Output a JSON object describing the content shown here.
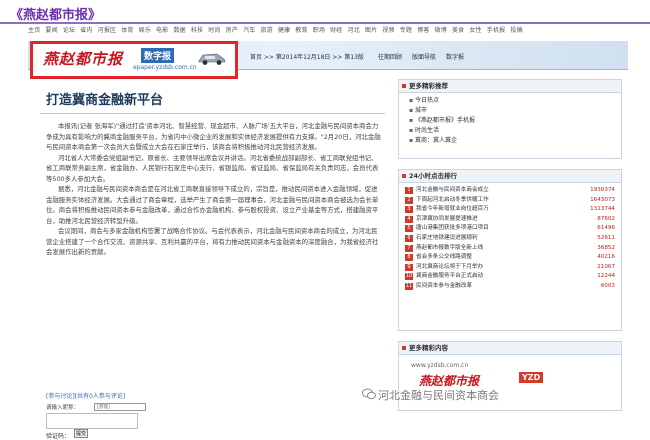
{
  "page_title": "《燕赵都市报》",
  "nav": [
    "主页",
    "要闻",
    "论坛",
    "省内",
    "河报区",
    "体育",
    "娱乐",
    "电影",
    "数据",
    "科技",
    "时尚",
    "房产",
    "汽车",
    "旅游",
    "健康",
    "教育",
    "职场",
    "财经",
    "河北",
    "图片",
    "视频",
    "专题",
    "博客",
    "微博",
    "美食",
    "女性",
    "手机报",
    "投稿"
  ],
  "banner": {
    "logo_text": "燕赵都市报",
    "digital_label": "数字报",
    "logo_url": "epaper.yzdsb.com.cn",
    "date_text": "首页 >> 第2014年12月18日 >> 第13版",
    "links": [
      "往期回顾",
      "版面导航",
      "数字报"
    ]
  },
  "article": {
    "title": "打造冀商金融新平台",
    "paragraphs": [
      "本报讯(记者 张海军)\"通过打造'资本河北、智慧经营、现金超市、人脉广场'五大平台，河北金融与民间资本商会力争成为具有影响力的冀商金融服务平台，为省内中小微企业的发展和实体经济发展提供有力支撑。\"2月20日，河北金融与民间资本商会第一次会员大会暨成立大会在石家庄举行，该商会将积极推动河北民营经济发展。",
      "河北省人大常委会党组副书记，原省长、主要领导出席会议并讲话。河北省委统战部副部长、省工商联党组书记、省工商联常务副主席，省金融办、人民银行石家庄中心支行、省银监局、省证监局、省保监局有关负责同志，会员代表等500多人参加大会。",
      "据悉，河北金融与民间资本商会是在河北省工商联直接领导下成立的，宗旨是，推动民间资本进入金融领域，促进金融服务实体经济发展。大会通过了商会章程，选举产生了商会第一届理事会，河北金融与民间资本商会被选为会长单位。商会将积极推动民间资本参与金融改革，通过合作办金融机构、参与股权投资、设立产业基金等方式，搭建融资平台，助推河北民营经济转型升级。",
      "会议期间，商会与多家金融机构签署了战略合作协议。与会代表表示，河北金融与民间资本商会的成立，为河北民营企业搭建了一个合作交流、资源共享、互利共赢的平台，将有力推动民间资本与金融资本的深度融合，为我省经济社会发展作出新的贡献。"
    ],
    "comment_head": "[参与讨论][共有0人参与评论]",
    "comment_label": "请输入昵称：",
    "comment_placeholder": "[游客]",
    "verify_label": "验证码：",
    "submit_label": "提交"
  },
  "sidebar": {
    "panel1_title": "更多精彩推荐",
    "panel1_items": [
      "今日热点",
      "城市",
      "《燕赵都市报》手机报",
      "时尚生活",
      "冀商：冀人冀企"
    ],
    "panel2_title": "24小时点击排行",
    "rank": [
      {
        "num": "1",
        "title": "河北金融与民间资本商会成立",
        "count": "1930374"
      },
      {
        "num": "2",
        "title": "下周起河北启动冬季供暖工作",
        "count": "1643073"
      },
      {
        "num": "3",
        "title": "我省今年新增就业岗位超百万",
        "count": "1313744"
      },
      {
        "num": "4",
        "title": "京津冀协同发展提速推进",
        "count": "87602"
      },
      {
        "num": "5",
        "title": "唐山港集团获批多项港口项目",
        "count": "61496"
      },
      {
        "num": "6",
        "title": "石家庄地铁建设进展顺利",
        "count": "52611"
      },
      {
        "num": "7",
        "title": "燕赵都市报数字版全新上线",
        "count": "36852"
      },
      {
        "num": "8",
        "title": "省会多条公交线路调整",
        "count": "40216"
      },
      {
        "num": "9",
        "title": "河北冀商论坛将于下月举办",
        "count": "21067"
      },
      {
        "num": "10",
        "title": "冀商金融服务平台正式启动",
        "count": "12244"
      },
      {
        "num": "11",
        "title": "民间资本参与金融改革",
        "count": "6003"
      }
    ],
    "panel3_title": "更多精彩内容",
    "ad_url": "www.yzdsb.com.cn",
    "ad_logo": "燕赵都市报",
    "ad_badge": "YZD"
  },
  "watermark": "河北金融与民间资本商会",
  "colors": {
    "accent": "#c8151d",
    "title_purple": "#6a2faf",
    "link_blue": "#2e6db4"
  }
}
